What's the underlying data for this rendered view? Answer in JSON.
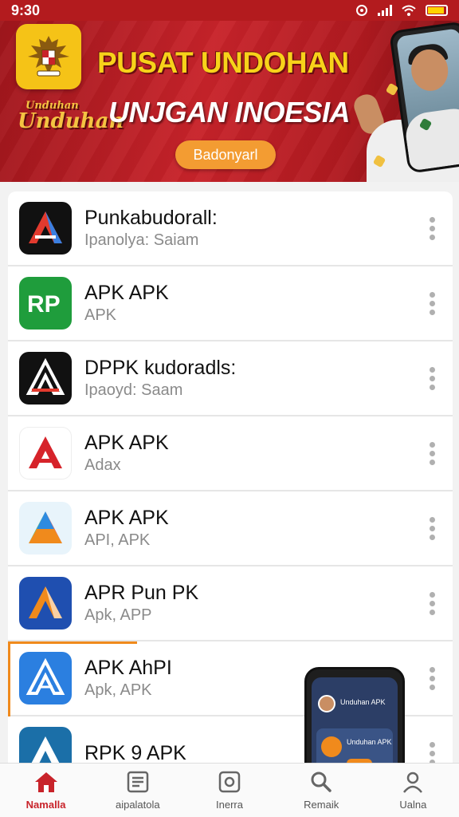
{
  "status_bar": {
    "time": "9:30"
  },
  "banner": {
    "title": "PUSAT UNDOHAN",
    "subtitle": "UNJGAN INOESIA",
    "brush_line1": "Unduhan",
    "brush_line2": "Unduhan",
    "button_label": "Badonyarl",
    "colors": {
      "background": "#b31b1e",
      "title": "#f7d21a",
      "button": "#f39c32"
    }
  },
  "apps": [
    {
      "name": "Punkabudorall:",
      "subtitle": "Ipanolya: Saiam",
      "icon": "red-blue-a-logo-icon"
    },
    {
      "name": "APK APK",
      "subtitle": "APK",
      "icon": "green-rp-logo-icon"
    },
    {
      "name": "DPPK kudoradls:",
      "subtitle": "Ipaoyd: Saam",
      "icon": "black-a-logo-icon"
    },
    {
      "name": "APK  APK",
      "subtitle": "Adax",
      "icon": "red-a-logo-icon"
    },
    {
      "name": "APK  APK",
      "subtitle": "API, APK",
      "icon": "multicolor-a-logo-icon"
    },
    {
      "name": "APR Pun PK",
      "subtitle": "Apk, APP",
      "icon": "blue-orange-a-logo-icon"
    },
    {
      "name": "APK AhPI",
      "subtitle": "Apk, APK",
      "icon": "blue-a-logo-icon"
    },
    {
      "name": "RPK 9 APK",
      "subtitle": "",
      "icon": "teal-a-logo-icon"
    }
  ],
  "floating_preview": {
    "title": "Unduhan APK",
    "card_text": "Unduhan APK"
  },
  "nav": {
    "items": [
      {
        "label": "Namalla",
        "icon": "home-icon",
        "active": true
      },
      {
        "label": "aipalatola",
        "icon": "list-icon",
        "active": false
      },
      {
        "label": "Inerra",
        "icon": "square-icon",
        "active": false
      },
      {
        "label": "Remaik",
        "icon": "search-icon",
        "active": false
      },
      {
        "label": "Ualna",
        "icon": "user-icon",
        "active": false
      }
    ],
    "active_color": "#c8232a"
  }
}
